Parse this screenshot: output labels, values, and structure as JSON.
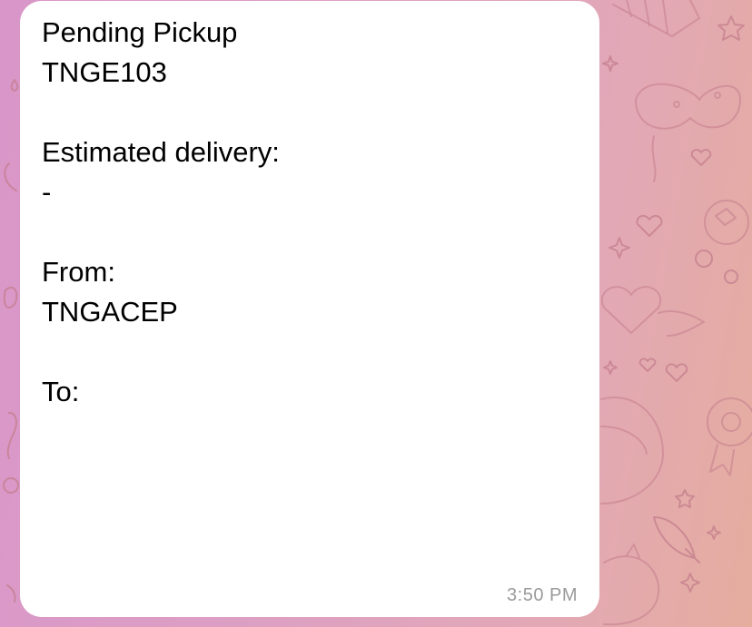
{
  "message": {
    "lines": [
      "Pending Pickup",
      "TNGE103",
      "",
      "Estimated delivery:",
      "-",
      "",
      "From:",
      "TNGACEP",
      "",
      "To:"
    ],
    "timestamp": "3:50 PM"
  },
  "theme": {
    "bubble_color": "#ffffff",
    "text_color": "#000000",
    "timestamp_color": "#9a9a9a",
    "wallpaper_gradient_start": "#d996c9",
    "wallpaper_gradient_end": "#e5ad9e",
    "wallpaper_doodle_color": "#c47e8c"
  }
}
